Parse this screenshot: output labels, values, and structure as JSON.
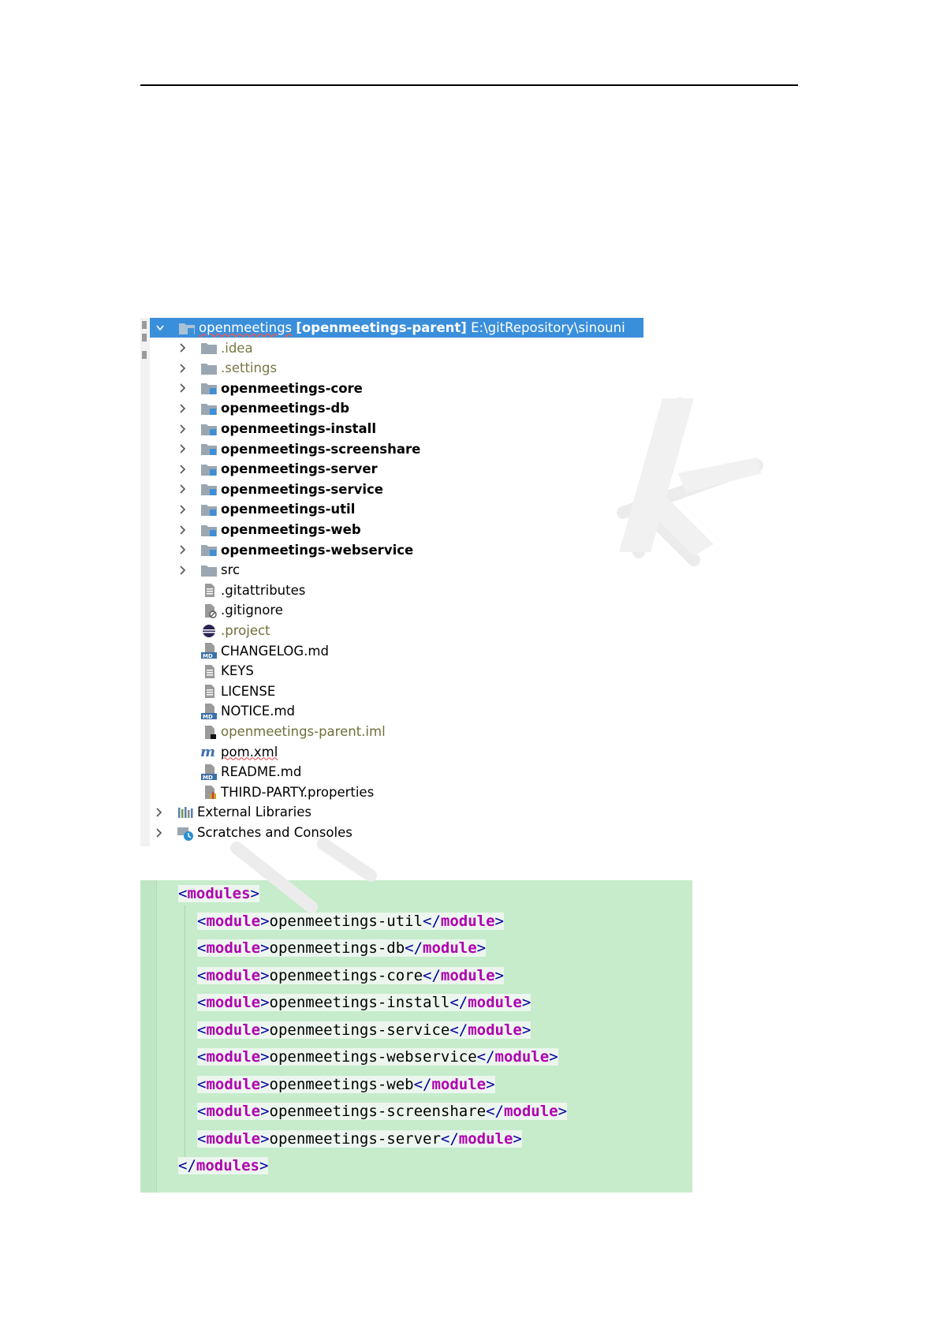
{
  "tree": {
    "root": {
      "name": "openmeetings",
      "module": "[openmeetings-parent]",
      "path": "E:\\gitRepository\\sinouni"
    },
    "folders": [
      {
        "label": ".idea",
        "style": "muted"
      },
      {
        "label": ".settings",
        "style": "muted"
      },
      {
        "label": "openmeetings-core",
        "style": "module"
      },
      {
        "label": "openmeetings-db",
        "style": "module"
      },
      {
        "label": "openmeetings-install",
        "style": "module"
      },
      {
        "label": "openmeetings-screenshare",
        "style": "module"
      },
      {
        "label": "openmeetings-server",
        "style": "module"
      },
      {
        "label": "openmeetings-service",
        "style": "module"
      },
      {
        "label": "openmeetings-util",
        "style": "module"
      },
      {
        "label": "openmeetings-web",
        "style": "module"
      },
      {
        "label": "openmeetings-webservice",
        "style": "module"
      },
      {
        "label": "src",
        "style": "plain"
      }
    ],
    "files": [
      {
        "label": ".gitattributes",
        "icon": "text-file-icon"
      },
      {
        "label": ".gitignore",
        "icon": "gitignore-file-icon"
      },
      {
        "label": ".project",
        "icon": "eclipse-project-icon"
      },
      {
        "label": "CHANGELOG.md",
        "icon": "markdown-file-icon"
      },
      {
        "label": "KEYS",
        "icon": "text-file-icon"
      },
      {
        "label": "LICENSE",
        "icon": "text-file-icon"
      },
      {
        "label": "NOTICE.md",
        "icon": "markdown-file-icon"
      },
      {
        "label": "openmeetings-parent.iml",
        "icon": "iml-file-icon"
      },
      {
        "label": "pom.xml",
        "icon": "maven-icon"
      },
      {
        "label": "README.md",
        "icon": "markdown-file-icon"
      },
      {
        "label": "THIRD-PARTY.properties",
        "icon": "properties-file-icon"
      }
    ],
    "bottom": [
      {
        "label": "External Libraries",
        "icon": "libraries-icon"
      },
      {
        "label": "Scratches and Consoles",
        "icon": "scratches-icon"
      }
    ]
  },
  "code": {
    "open_tag": "modules",
    "module_tag": "module",
    "modules": [
      "openmeetings-util",
      "openmeetings-db",
      "openmeetings-core",
      "openmeetings-install",
      "openmeetings-service",
      "openmeetings-webservice",
      "openmeetings-web",
      "openmeetings-screenshare",
      "openmeetings-server"
    ]
  },
  "colors": {
    "selection": "#3a8fdb",
    "code_background": "#c6eccb",
    "xml_keyword": "#b000b0",
    "xml_bracket": "#0000a0"
  }
}
